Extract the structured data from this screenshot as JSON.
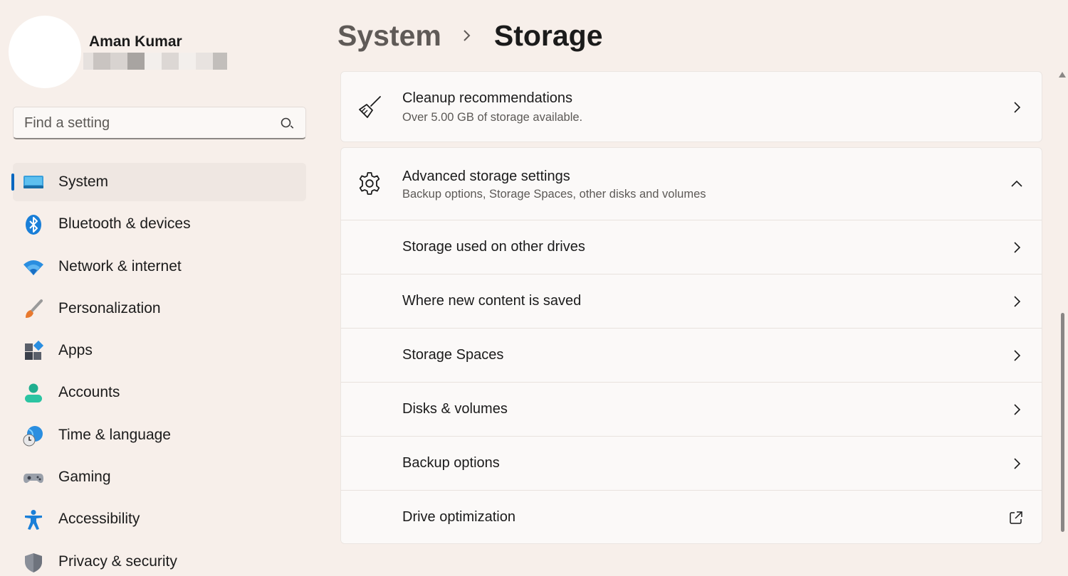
{
  "profile": {
    "name": "Aman Kumar",
    "email_blocks": [
      "#e6e1de",
      "#c9c4c1",
      "#d8d3d0",
      "#a8a4a1",
      "#f3efec",
      "#dcd7d4",
      "#f3efec",
      "#e8e3e0",
      "#c2bebb"
    ]
  },
  "search": {
    "placeholder": "Find a setting"
  },
  "nav": {
    "items": [
      {
        "label": "System",
        "icon": "system-icon",
        "active": true
      },
      {
        "label": "Bluetooth & devices",
        "icon": "bluetooth-icon"
      },
      {
        "label": "Network & internet",
        "icon": "wifi-icon"
      },
      {
        "label": "Personalization",
        "icon": "brush-icon"
      },
      {
        "label": "Apps",
        "icon": "apps-icon"
      },
      {
        "label": "Accounts",
        "icon": "account-icon"
      },
      {
        "label": "Time & language",
        "icon": "globe-clock-icon"
      },
      {
        "label": "Gaming",
        "icon": "gamepad-icon"
      },
      {
        "label": "Accessibility",
        "icon": "accessibility-icon"
      },
      {
        "label": "Privacy & security",
        "icon": "shield-icon"
      }
    ]
  },
  "breadcrumb": {
    "parent": "System",
    "current": "Storage"
  },
  "cleanup": {
    "title": "Cleanup recommendations",
    "subtitle": "Over 5.00 GB of storage available."
  },
  "advanced": {
    "title": "Advanced storage settings",
    "subtitle": "Backup options, Storage Spaces, other disks and volumes",
    "items": [
      {
        "label": "Storage used on other drives",
        "icon": "chevron-right-icon"
      },
      {
        "label": "Where new content is saved",
        "icon": "chevron-right-icon"
      },
      {
        "label": "Storage Spaces",
        "icon": "chevron-right-icon"
      },
      {
        "label": "Disks & volumes",
        "icon": "chevron-right-icon"
      },
      {
        "label": "Backup options",
        "icon": "chevron-right-icon"
      },
      {
        "label": "Drive optimization",
        "icon": "external-link-icon"
      }
    ]
  },
  "colors": {
    "accent": "#0067c0",
    "background": "#f7efea",
    "card": "#fbf9f8"
  }
}
